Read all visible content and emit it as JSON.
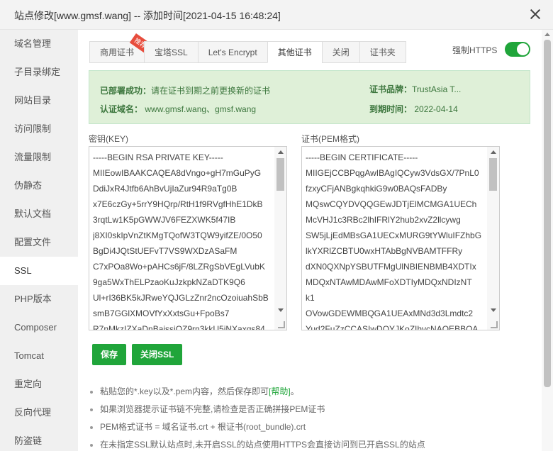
{
  "window": {
    "title": "站点修改[www.gmsf.wang] -- 添加时间[2021-04-15 16:48:24]"
  },
  "sidebar": {
    "items": [
      {
        "label": "域名管理"
      },
      {
        "label": "子目录绑定"
      },
      {
        "label": "网站目录"
      },
      {
        "label": "访问限制"
      },
      {
        "label": "流量限制"
      },
      {
        "label": "伪静态"
      },
      {
        "label": "默认文档"
      },
      {
        "label": "配置文件"
      },
      {
        "label": "SSL"
      },
      {
        "label": "PHP版本"
      },
      {
        "label": "Composer"
      },
      {
        "label": "Tomcat"
      },
      {
        "label": "重定向"
      },
      {
        "label": "反向代理"
      },
      {
        "label": "防盗链"
      }
    ],
    "active": "SSL"
  },
  "tabs": [
    {
      "label": "商用证书",
      "badge": "推荐"
    },
    {
      "label": "宝塔SSL"
    },
    {
      "label": "Let's Encrypt"
    },
    {
      "label": "其他证书"
    },
    {
      "label": "关闭"
    },
    {
      "label": "证书夹"
    }
  ],
  "active_tab": "其他证书",
  "force_https": {
    "label": "强制HTTPS",
    "enabled": true
  },
  "cert_info": {
    "deployed_label": "已部署成功：",
    "deployed_text": "请在证书到期之前更换新的证书",
    "domain_label": "认证域名：",
    "domain_value": "www.gmsf.wang、gmsf.wang",
    "brand_label": "证书品牌：",
    "brand_value": "TrustAsia T...",
    "expire_label": "到期时间：",
    "expire_value": "2022-04-14"
  },
  "key_box": {
    "label": "密钥(KEY)",
    "content": "-----BEGIN RSA PRIVATE KEY-----\nMIIEowIBAAKCAQEA8dVngo+gH7mGuPyG\nDdiJxR4Jtfb6AhBvUjIaZur94R9aTg0B\nx7E6czGy+5rrY9HQrp/RtH1f9RVgfHhE1DkB\n3rqtLw1K5pGWWJV6FEZXWK5f47IB\nj8XI0skIpVnZtKMgTQofW3TQW9yifZE/0O50\nBgDi4JQtStUEFvT7VS9WXDzASaFM\nC7xPOa8Wo+pAHCs6jF/8LZRgSbVEgLVubK\n9ga5WxThELPzaoKuJzkpkNZaDTK9Q6\nUl+rI36BK5kJRweYQJGLzZnr2ncOzoiuahSbB\nsmB7GGlXMOVfYxXxtsGu+FpoBs7\nR7nMkzIZXaDnBaissiOZ9rn3kkU5iNXaxqs84"
  },
  "cert_box": {
    "label": "证书(PEM格式)",
    "content": "-----BEGIN CERTIFICATE-----\nMIIGEjCCBPqgAwIBAgIQCyw3VdsGX/7PnL0\nfzxyCFjANBgkqhkiG9w0BAQsFADBy\nMQswCQYDVQQGEwJDTjElMCMGA1UECh\nMcVHJ1c3RBc2lhIFRlY2hub2xvZ2llcywg\nSW5jLjEdMBsGA1UECxMURG9tYWluIFZhbG\nlkYXRlZCBTU0wxHTAbBgNVBAMTFFRy\ndXN0QXNpYSBUTFMgUlNBIENBMB4XDTIx\nMDQxNTAwMDAwMFoXDTIyMDQxNDIzNT\nk1\nOVowGDEWMBQGA1UEAxMNd3d3Lmdtc2\nYud2FuZzCCASIwDQYJKoZIhvcNAQEBBQA"
  },
  "buttons": {
    "save": "保存",
    "close_ssl": "关闭SSL"
  },
  "notes": {
    "n1_before": "粘贴您的*.key以及*.pem内容，然后保存即可",
    "n1_help": "[帮助]",
    "n1_after": "。",
    "n2": "如果浏览器提示证书链不完整,请检查是否正确拼接PEM证书",
    "n3": "PEM格式证书 = 域名证书.crt + 根证书(root_bundle).crt",
    "n4": "在未指定SSL默认站点时,未开启SSL的站点使用HTTPS会直接访问到已开启SSL的站点"
  },
  "colors": {
    "accent": "#20a53a",
    "info_bg": "#dff0d8",
    "badge": "#e74c3c"
  }
}
